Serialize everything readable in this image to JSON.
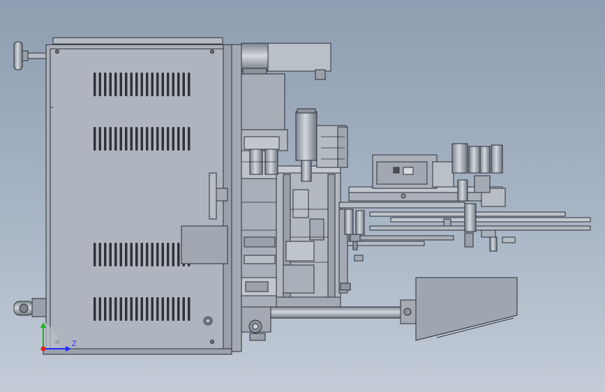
{
  "viewport": {
    "background_top": "#8e9db1",
    "background_bottom": "#c3ccd7",
    "model_fill": "#a9b0b9",
    "model_fill_light": "#bcc3cb",
    "model_fill_dark": "#8a929c",
    "edge_color": "#2b2f35"
  },
  "triad": {
    "z_label": "Z",
    "z_color": "#1f2cff",
    "y_color": "#1bb51b",
    "origin_color": "#e02020"
  }
}
